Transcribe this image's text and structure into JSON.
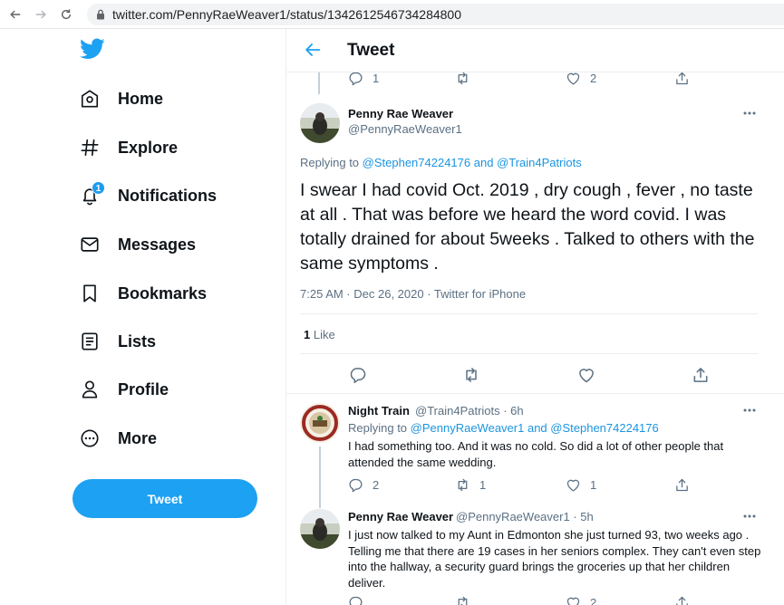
{
  "browser": {
    "url": "twitter.com/PennyRaeWeaver1/status/1342612546734284800"
  },
  "sidebar": {
    "items": [
      {
        "label": "Home"
      },
      {
        "label": "Explore"
      },
      {
        "label": "Notifications",
        "badge": "1"
      },
      {
        "label": "Messages"
      },
      {
        "label": "Bookmarks"
      },
      {
        "label": "Lists"
      },
      {
        "label": "Profile"
      },
      {
        "label": "More"
      }
    ],
    "tweet_button": "Tweet"
  },
  "header": {
    "title": "Tweet"
  },
  "prev_tweet": {
    "reply_count": "1",
    "like_count": "2"
  },
  "main_tweet": {
    "name": "Penny Rae Weaver",
    "handle": "@PennyRaeWeaver1",
    "replying_prefix": "Replying to ",
    "replying_user1": "@Stephen74224176",
    "replying_and": " and ",
    "replying_user2": "@Train4Patriots",
    "text": "I swear I had covid Oct. 2019 , dry cough , fever , no taste at all . That was before we heard the word covid. I was totally drained for about 5weeks . Talked to others with the same symptoms .",
    "meta": "7:25 AM · Dec 26, 2020 · Twitter for iPhone",
    "like_count": "1",
    "like_label": " Like"
  },
  "replies": [
    {
      "name": "Night Train",
      "handle": "@Train4Patriots · 6h",
      "replying_prefix": "Replying to ",
      "replying_user1": "@PennyRaeWeaver1",
      "replying_and": " and ",
      "replying_user2": "@Stephen74224176",
      "text": "I had something too. And it was no cold. So did a lot of other people that attended the same wedding.",
      "reply_count": "2",
      "retweet_count": "1",
      "like_count": "1"
    },
    {
      "name": "Penny Rae Weaver",
      "handle": "@PennyRaeWeaver1 · 5h",
      "text": "I just now talked to my Aunt in Edmonton she just turned 93, two weeks ago . Telling me that there are 19 cases in her seniors complex. They can't even step into the hallway, a security guard brings the groceries up that her children deliver.",
      "like_count": "2"
    }
  ],
  "colors": {
    "accent": "#1da1f2",
    "link": "#1b95e0",
    "secondary_text": "#5b7083",
    "divider": "#ebeef0"
  },
  "icons": [
    "back-arrow-icon",
    "refresh-icon",
    "lock-icon",
    "twitter-bird-icon",
    "home-icon",
    "hashtag-icon",
    "bell-icon",
    "envelope-icon",
    "bookmark-icon",
    "list-icon",
    "person-icon",
    "more-circle-icon",
    "reply-icon",
    "retweet-icon",
    "heart-icon",
    "share-icon",
    "more-dots-icon"
  ]
}
